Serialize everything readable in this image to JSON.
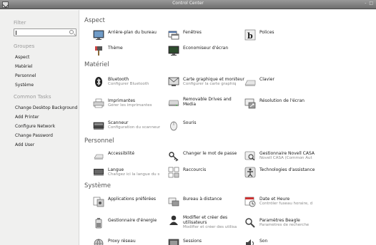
{
  "window": {
    "title": "Control Center",
    "controls": "- □"
  },
  "sidebar": {
    "filter_label": "Filter",
    "groups_label": "Groupes",
    "groups": [
      "Aspect",
      "Matériel",
      "Personnel",
      "Système"
    ],
    "common_tasks_label": "Common Tasks",
    "tasks": [
      "Change Desktop Background",
      "Add Printer",
      "Configure Network",
      "Change Password",
      "Add User"
    ]
  },
  "categories": {
    "aspect": {
      "title": "Aspect",
      "items": [
        {
          "name": "Arrière-plan du bureau",
          "icon": "desktop-background-icon"
        },
        {
          "name": "Fenêtres",
          "icon": "windows-icon"
        },
        {
          "name": "Polices",
          "icon": "fonts-icon"
        },
        {
          "name": "Thème",
          "icon": "theme-icon"
        },
        {
          "name": "Economiseur d'écran",
          "icon": "screensaver-icon"
        }
      ]
    },
    "materiel": {
      "title": "Matériel",
      "items": [
        {
          "name": "Bluetooth",
          "desc": "Configurer Bluetooth",
          "icon": "bluetooth-icon"
        },
        {
          "name": "Carte graphique et moniteur",
          "desc": "Configurer la carte graphiq",
          "icon": "monitor-icon"
        },
        {
          "name": "Clavier",
          "icon": "keyboard-icon"
        },
        {
          "name": "Imprimantes",
          "desc": "Gérer les imprimantes",
          "icon": "printer-icon"
        },
        {
          "name": "Removable Drives and Media",
          "icon": "removable-drive-icon"
        },
        {
          "name": "Résolution de l'écran",
          "icon": "screen-resolution-icon"
        },
        {
          "name": "Scanneur",
          "desc": "Configuration du scanneur",
          "icon": "scanner-icon"
        },
        {
          "name": "Souris",
          "icon": "mouse-icon"
        }
      ]
    },
    "personnel": {
      "title": "Personnel",
      "items": [
        {
          "name": "Accessibilité",
          "icon": "accessibility-icon"
        },
        {
          "name": "Changer le mot de passe",
          "icon": "password-icon"
        },
        {
          "name": "Gestionnaire Novell CASA",
          "desc": "Novell CASA (Common Aut",
          "icon": "casa-icon"
        },
        {
          "name": "Langue",
          "desc": "Changez ici la langue du s",
          "icon": "language-icon"
        },
        {
          "name": "Raccourcis",
          "icon": "shortcuts-icon"
        },
        {
          "name": "Technologies d'assistance",
          "icon": "assistive-tech-icon"
        }
      ]
    },
    "systeme": {
      "title": "Système",
      "items": [
        {
          "name": "Applications préférées",
          "icon": "preferred-apps-icon"
        },
        {
          "name": "Bureau à distance",
          "icon": "remote-desktop-icon"
        },
        {
          "name": "Date et Heure",
          "desc": "Contrôler fuseau horaire, d",
          "icon": "date-time-icon"
        },
        {
          "name": "Gestionnaire d'énergie",
          "icon": "power-manager-icon"
        },
        {
          "name": "Modifier et créer des utilisateurs",
          "desc": "Modifier et créer des utilisa",
          "icon": "users-icon"
        },
        {
          "name": "Paramètres Beagle",
          "desc": "Paramètres de recherche",
          "icon": "beagle-icon"
        },
        {
          "name": "Proxy réseau",
          "icon": "network-proxy-icon"
        },
        {
          "name": "Sessions",
          "icon": "sessions-icon"
        },
        {
          "name": "Son",
          "icon": "sound-icon"
        }
      ]
    }
  }
}
